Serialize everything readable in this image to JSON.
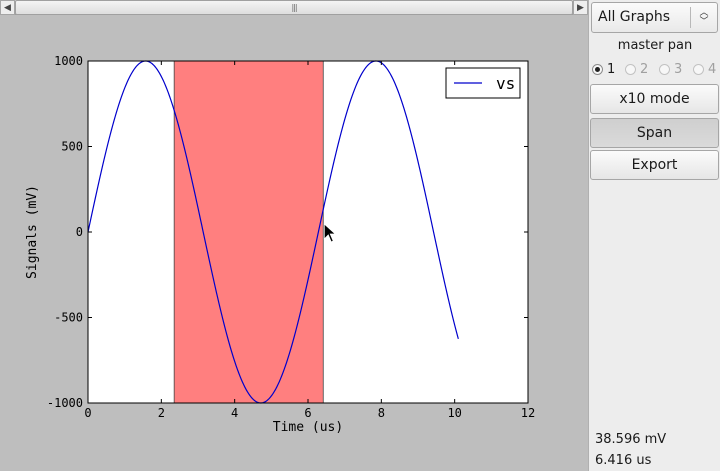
{
  "scrollbar": {
    "left_arrow": "◀",
    "right_arrow": "▶",
    "grip": "|||"
  },
  "panel": {
    "graph_select": "All Graphs",
    "pan_label": "master pan",
    "radios": [
      {
        "label": "1",
        "selected": true,
        "enabled": true
      },
      {
        "label": "2",
        "selected": false,
        "enabled": false
      },
      {
        "label": "3",
        "selected": false,
        "enabled": false
      },
      {
        "label": "4",
        "selected": false,
        "enabled": false
      }
    ],
    "x10_button": "x10 mode",
    "span_button": "Span",
    "export_button": "Export",
    "readout_value": "38.596 mV",
    "readout_time": "6.416 us"
  },
  "chart_data": {
    "type": "line",
    "xlabel": "Time (us)",
    "ylabel": "Signals (mV)",
    "xlim": [
      0,
      12
    ],
    "ylim": [
      -1000,
      1000
    ],
    "xticks": [
      0,
      2,
      4,
      6,
      8,
      10,
      12
    ],
    "yticks": [
      -1000,
      -500,
      0,
      500,
      1000
    ],
    "legend_position": "top-right",
    "series": [
      {
        "name": "vs",
        "color": "#0000cc",
        "function": "1000*sin(x)",
        "x_range": [
          0,
          10.1
        ]
      }
    ],
    "span": {
      "x_start": 2.35,
      "x_end": 6.416,
      "color": "#ff7f7f"
    }
  }
}
